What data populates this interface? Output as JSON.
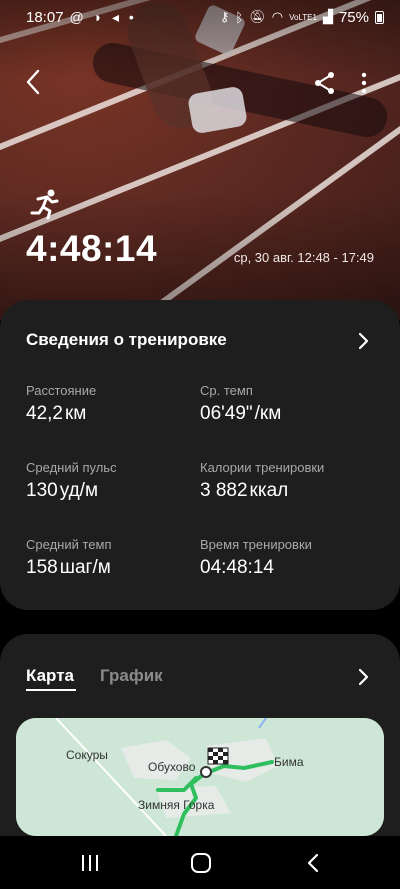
{
  "status_bar": {
    "time": "18:07",
    "notification_glyphs": "@ ◗ ◂ •",
    "network_label": "VoLTE1",
    "battery": "75%"
  },
  "hero": {
    "activity_icon": "running-icon",
    "duration": "4:48:14",
    "date_range": "ср, 30 авг. 12:48 - 17:49"
  },
  "workout": {
    "title": "Сведения о тренировке",
    "stats": [
      {
        "label": "Расстояние",
        "value": "42,2",
        "unit": "км"
      },
      {
        "label": "Ср. темп",
        "value": "06'49\"",
        "unit": "/км"
      },
      {
        "label": "Средний пульс",
        "value": "130",
        "unit": "уд/м"
      },
      {
        "label": "Калории тренировки",
        "value": "3 882",
        "unit": "ккал"
      },
      {
        "label": "Средний темп",
        "value": "158",
        "unit": "шаг/м"
      },
      {
        "label": "Время тренировки",
        "value": "04:48:14",
        "unit": ""
      }
    ]
  },
  "map_section": {
    "tabs": [
      {
        "label": "Карта",
        "active": true
      },
      {
        "label": "График",
        "active": false
      }
    ],
    "places": [
      "Сокуры",
      "Обухово",
      "Бима",
      "Зимняя Горка"
    ]
  },
  "colors": {
    "card_bg": "#1e1e1e",
    "route": "#2fbf5f",
    "track": "#6b2e24"
  }
}
